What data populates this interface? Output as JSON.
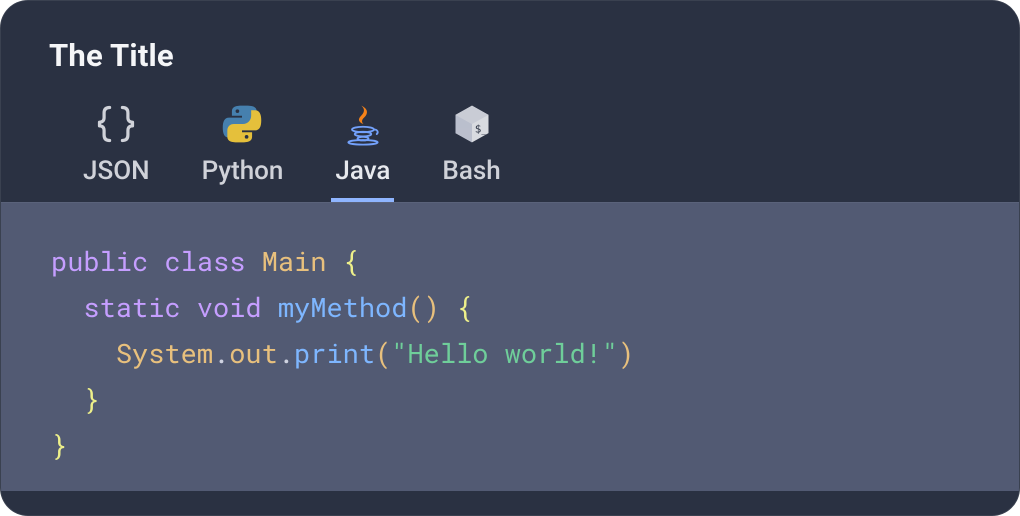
{
  "title": "The Title",
  "tabs": [
    {
      "id": "json",
      "label": "JSON",
      "icon": "braces-icon",
      "active": false
    },
    {
      "id": "python",
      "label": "Python",
      "icon": "python-logo-icon",
      "active": false
    },
    {
      "id": "java",
      "label": "Java",
      "icon": "java-logo-icon",
      "active": true
    },
    {
      "id": "bash",
      "label": "Bash",
      "icon": "terminal-cube-icon",
      "active": false
    }
  ],
  "accent_color": "#8fb5ff",
  "active_tab_id": "java",
  "code": {
    "language": "java",
    "tokens": [
      {
        "indent": 0,
        "parts": [
          {
            "t": "public ",
            "c": "kw"
          },
          {
            "t": "class ",
            "c": "kw"
          },
          {
            "t": "Main ",
            "c": "class"
          },
          {
            "t": "{",
            "c": "punc"
          }
        ]
      },
      {
        "indent": 1,
        "parts": [
          {
            "t": "static ",
            "c": "kw"
          },
          {
            "t": "void ",
            "c": "kw"
          },
          {
            "t": "myMethod",
            "c": "method"
          },
          {
            "t": "()",
            "c": "paren"
          },
          {
            "t": " ",
            "c": ""
          },
          {
            "t": "{",
            "c": "punc"
          }
        ]
      },
      {
        "indent": 2,
        "parts": [
          {
            "t": "System",
            "c": "obj"
          },
          {
            "t": ".",
            "c": "dot"
          },
          {
            "t": "out",
            "c": "obj"
          },
          {
            "t": ".",
            "c": "dot"
          },
          {
            "t": "print",
            "c": "method"
          },
          {
            "t": "(",
            "c": "paren"
          },
          {
            "t": "\"Hello world!\"",
            "c": "str"
          },
          {
            "t": ")",
            "c": "paren"
          }
        ]
      },
      {
        "indent": 1,
        "parts": [
          {
            "t": "}",
            "c": "punc"
          }
        ]
      },
      {
        "indent": 0,
        "parts": [
          {
            "t": "}",
            "c": "punc"
          }
        ]
      }
    ]
  }
}
